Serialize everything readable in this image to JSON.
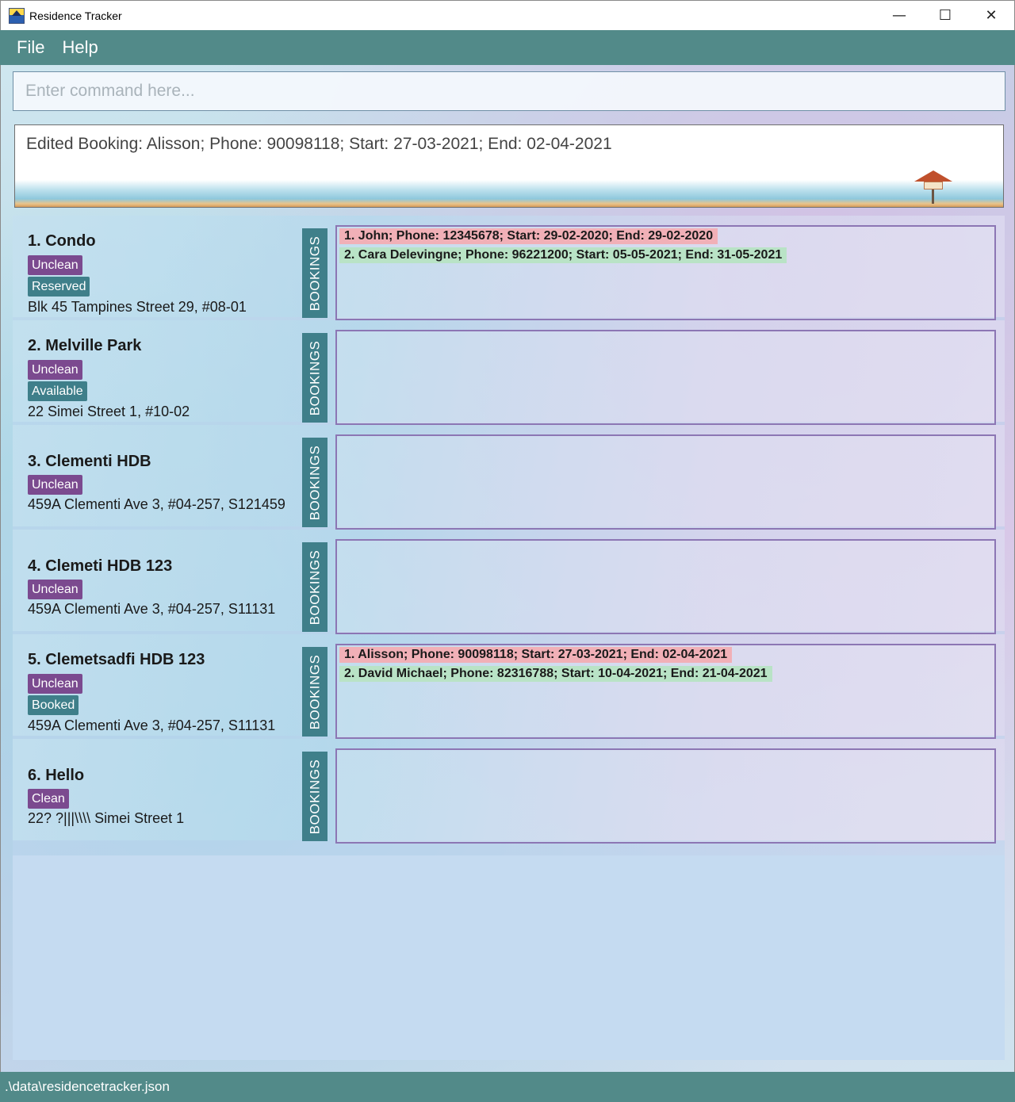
{
  "window": {
    "title": "Residence Tracker",
    "controls": {
      "minimize": "—",
      "maximize": "☐",
      "close": "✕"
    }
  },
  "menu": {
    "file": "File",
    "help": "Help"
  },
  "command": {
    "placeholder": "Enter command here...",
    "value": ""
  },
  "result": {
    "text": "Edited Booking: Alisson; Phone: 90098118; Start: 27-03-2021; End: 02-04-2021"
  },
  "residences": [
    {
      "title": "1.  Condo",
      "clean": "Unclean",
      "status": "Reserved",
      "address": "Blk 45 Tampines Street 29, #08-01",
      "bookings_label": "BOOKINGS",
      "bookings": [
        {
          "text": "1. John; Phone: 12345678; Start: 29-02-2020; End: 29-02-2020",
          "kind": "past"
        },
        {
          "text": "2. Cara Delevingne; Phone: 96221200; Start: 05-05-2021; End: 31-05-2021",
          "kind": "future"
        }
      ]
    },
    {
      "title": "2.  Melville Park",
      "clean": "Unclean",
      "status": "Available",
      "address": "22 Simei Street 1, #10-02",
      "bookings_label": "BOOKINGS",
      "bookings": []
    },
    {
      "title": "3.  Clementi HDB",
      "clean": "Unclean",
      "status": "",
      "address": "459A Clementi Ave 3, #04-257, S121459",
      "bookings_label": "BOOKINGS",
      "bookings": []
    },
    {
      "title": "4.  Clemeti HDB 123",
      "clean": "Unclean",
      "status": "",
      "address": "459A Clementi Ave 3, #04-257, S11131",
      "bookings_label": "BOOKINGS",
      "bookings": []
    },
    {
      "title": "5.  Clemetsadfi HDB 123",
      "clean": "Unclean",
      "status": "Booked",
      "address": "459A Clementi Ave 3, #04-257, S11131",
      "bookings_label": "BOOKINGS",
      "bookings": [
        {
          "text": "1. Alisson; Phone: 90098118; Start: 27-03-2021; End: 02-04-2021",
          "kind": "past"
        },
        {
          "text": "2. David Michael; Phone: 82316788; Start: 10-04-2021; End: 21-04-2021",
          "kind": "future"
        }
      ]
    },
    {
      "title": "6.  Hello",
      "clean": "Clean",
      "status": "",
      "address": "22? ?|||\\\\\\\\ Simei Street 1",
      "bookings_label": "BOOKINGS",
      "bookings": []
    }
  ],
  "statusbar": {
    "path": ".\\data\\residencetracker.json"
  }
}
